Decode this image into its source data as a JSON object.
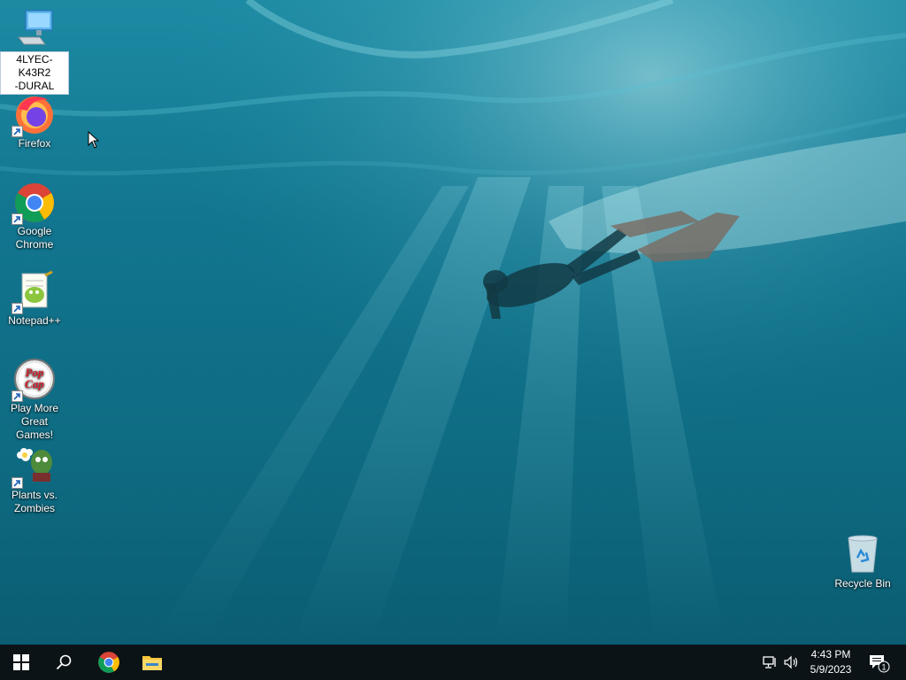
{
  "desktop": {
    "icons": [
      {
        "label": "4LYEC-K43R2\n-DURAL",
        "icon": "computer-icon",
        "selected": true
      },
      {
        "label": "Firefox",
        "icon": "firefox-icon"
      },
      {
        "label": "Google Chrome",
        "icon": "chrome-icon"
      },
      {
        "label": "Notepad++",
        "icon": "notepadpp-icon"
      },
      {
        "label": "Play More Great Games!",
        "icon": "popcap-icon"
      },
      {
        "label": "Plants vs. Zombies",
        "icon": "pvz-icon"
      },
      {
        "label": "Recycle Bin",
        "icon": "recycle-bin-icon"
      }
    ]
  },
  "taskbar": {
    "start": "windows-start-icon",
    "search": "search-icon",
    "pinned": [
      "chrome-icon",
      "file-explorer-icon"
    ],
    "tray": [
      "network-icon",
      "volume-icon"
    ],
    "clock": {
      "time": "4:43 PM",
      "date": "5/9/2023"
    },
    "notifications": {
      "icon": "action-center-icon",
      "count": "1"
    }
  },
  "colors": {
    "taskbar": "#0c1317",
    "water": "#0f6f86",
    "selection": "#ffffff"
  }
}
